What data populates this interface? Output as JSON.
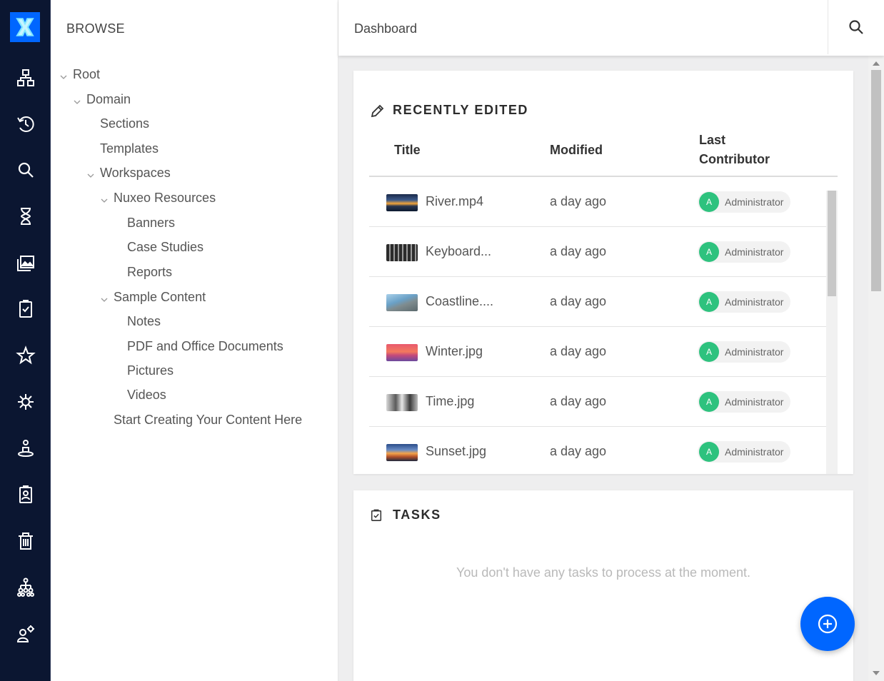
{
  "colors": {
    "rail_bg": "#0b1631",
    "accent": "#0066ff",
    "avatar": "#2ec27e"
  },
  "rail": {
    "logo_icon": "nuxeo-x-logo",
    "items": [
      {
        "icon": "browse-tree-icon"
      },
      {
        "icon": "history-icon"
      },
      {
        "icon": "search-icon"
      },
      {
        "icon": "hourglass-icon"
      },
      {
        "icon": "collections-icon"
      },
      {
        "icon": "tasks-icon"
      },
      {
        "icon": "star-icon"
      },
      {
        "icon": "virus-icon"
      },
      {
        "icon": "user-location-icon"
      },
      {
        "icon": "badge-icon"
      },
      {
        "icon": "trash-icon"
      },
      {
        "icon": "org-chart-icon"
      },
      {
        "icon": "user-settings-icon"
      }
    ]
  },
  "browse": {
    "title": "BROWSE",
    "tree": [
      {
        "label": "Root",
        "expanded": true
      },
      {
        "label": "Domain",
        "expanded": true
      },
      {
        "label": "Sections"
      },
      {
        "label": "Templates"
      },
      {
        "label": "Workspaces",
        "expanded": true
      },
      {
        "label": "Nuxeo Resources",
        "expanded": true
      },
      {
        "label": "Banners"
      },
      {
        "label": "Case Studies"
      },
      {
        "label": "Reports"
      },
      {
        "label": "Sample Content",
        "expanded": true
      },
      {
        "label": "Notes"
      },
      {
        "label": "PDF and Office Documents"
      },
      {
        "label": "Pictures"
      },
      {
        "label": "Videos"
      },
      {
        "label": "Start Creating Your Content Here"
      }
    ]
  },
  "header": {
    "title": "Dashboard",
    "search_icon": "search-icon"
  },
  "recently_edited": {
    "heading": "RECENTLY EDITED",
    "icon": "pencil-icon",
    "columns": {
      "title": "Title",
      "modified": "Modified",
      "contributor_line1": "Last",
      "contributor_line2": "Contributor"
    },
    "rows": [
      {
        "title": "River.mp4",
        "modified": "a day ago",
        "contributor": "Administrator",
        "initial": "A"
      },
      {
        "title": "Keyboard...",
        "modified": "a day ago",
        "contributor": "Administrator",
        "initial": "A"
      },
      {
        "title": "Coastline....",
        "modified": "a day ago",
        "contributor": "Administrator",
        "initial": "A"
      },
      {
        "title": "Winter.jpg",
        "modified": "a day ago",
        "contributor": "Administrator",
        "initial": "A"
      },
      {
        "title": "Time.jpg",
        "modified": "a day ago",
        "contributor": "Administrator",
        "initial": "A"
      },
      {
        "title": "Sunset.jpg",
        "modified": "a day ago",
        "contributor": "Administrator",
        "initial": "A"
      }
    ]
  },
  "tasks": {
    "heading": "TASKS",
    "icon": "task-checklist-icon",
    "empty_message": "You don't have any tasks to process at the moment."
  },
  "fab": {
    "icon": "add-circle-icon"
  }
}
